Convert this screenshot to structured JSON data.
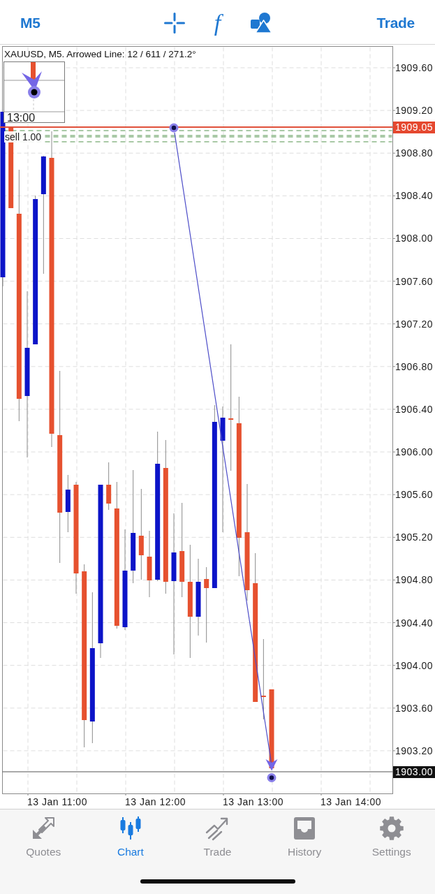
{
  "top_bar": {
    "timeframe": "M5",
    "function_symbol": "f",
    "action": "Trade"
  },
  "chart": {
    "title": "XAUUSD, M5. Arrowed Line: 12 / 611 / 271.2°",
    "overlay_labels": [
      "13:00",
      "sell 1.00"
    ],
    "price_labels": [
      "1909.60",
      "1909.20",
      "1908.80",
      "1908.40",
      "1908.00",
      "1907.60",
      "1907.20",
      "1906.80",
      "1906.40",
      "1906.00",
      "1905.60",
      "1905.20",
      "1904.80",
      "1904.40",
      "1904.00",
      "1903.60",
      "1903.20"
    ],
    "bid_label": "1909.05",
    "last_label": "1903.00",
    "time_labels": [
      "13 Jan 11:00",
      "13 Jan 12:00",
      "13 Jan 13:00",
      "13 Jan 14:00"
    ]
  },
  "tabs": [
    {
      "label": "Quotes",
      "selected": false
    },
    {
      "label": "Chart",
      "selected": true
    },
    {
      "label": "Trade",
      "selected": false
    },
    {
      "label": "History",
      "selected": false
    },
    {
      "label": "Settings",
      "selected": false
    }
  ]
}
